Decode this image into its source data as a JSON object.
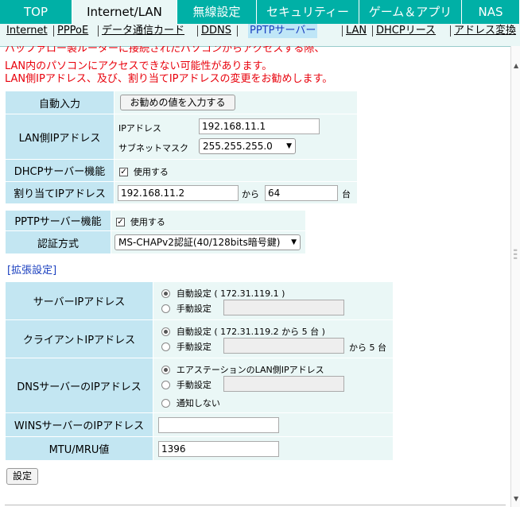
{
  "top_tabs": [
    {
      "label": "TOP"
    },
    {
      "label": "Internet/LAN",
      "active": true
    },
    {
      "label": "無線設定"
    },
    {
      "label": "セキュリティー"
    },
    {
      "label": "ゲーム＆アプリ"
    },
    {
      "label": "NAS"
    }
  ],
  "sub_tabs": [
    {
      "label": "Internet"
    },
    {
      "label": "PPPoE"
    },
    {
      "label": "データ通信カード"
    },
    {
      "label": "DDNS"
    },
    {
      "label": "PPTPサーバー",
      "active": true
    },
    {
      "label": "LAN"
    },
    {
      "label": "DHCPリース"
    },
    {
      "label": "アドレス変換"
    }
  ],
  "warning": {
    "line1": "バッファロー製ルーターに接続されたパソコンからアクセスする際、",
    "line2": "LAN内のパソコンにアクセスできない可能性があります。",
    "line3": "LAN側IPアドレス、及び、割り当てIPアドレスの変更をお勧めします。"
  },
  "lan_table": {
    "auto_input_label": "自動入力",
    "auto_input_button": "お勧めの値を入力する",
    "lan_ip_label": "LAN側IPアドレス",
    "ip_address_label": "IPアドレス",
    "ip_address_value": "192.168.11.1",
    "subnet_label": "サブネットマスク",
    "subnet_value": "255.255.255.0",
    "dhcp_label": "DHCPサーバー機能",
    "dhcp_use": "使用する",
    "assign_ip_label": "割り当てIPアドレス",
    "assign_ip_start": "192.168.11.2",
    "assign_from": "から",
    "assign_count": "64",
    "assign_unit": "台"
  },
  "pptp_table": {
    "server_label": "PPTPサーバー機能",
    "server_use": "使用する",
    "auth_label": "認証方式",
    "auth_value": "MS-CHAPv2認証(40/128bits暗号鍵)"
  },
  "extended_heading": "[拡張設定]",
  "ext_table": {
    "server_ip_label": "サーバーIPアドレス",
    "server_ip_auto": "自動設定 ( 172.31.119.1 )",
    "server_ip_manual": "手動設定",
    "client_ip_label": "クライアントIPアドレス",
    "client_ip_auto": "自動設定 ( 172.31.119.2 から 5 台 )",
    "client_ip_manual": "手動設定",
    "client_ip_suffix": "から 5 台",
    "dns_label": "DNSサーバーのIPアドレス",
    "dns_option1": "エアステーションのLAN側IPアドレス",
    "dns_option2": "手動設定",
    "dns_option3": "通知しない",
    "wins_label": "WINSサーバーのIPアドレス",
    "wins_value": "",
    "mtu_label": "MTU/MRU値",
    "mtu_value": "1396"
  },
  "submit_button": "設定"
}
